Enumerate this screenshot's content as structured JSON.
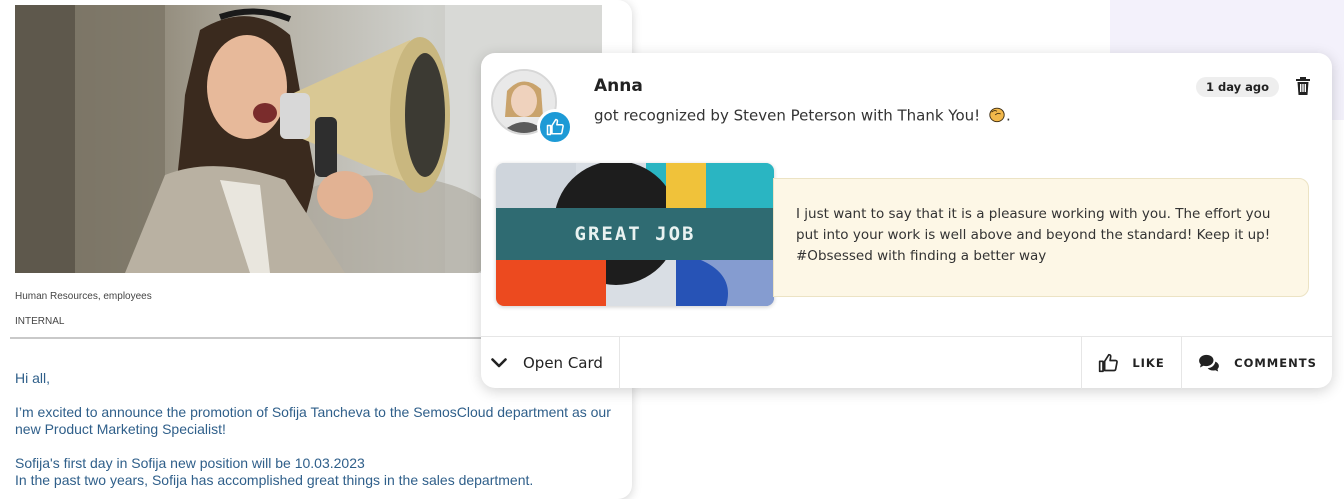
{
  "post": {
    "tags": "Human Resources, employees",
    "visibility": "INTERNAL",
    "greeting": "Hi all,",
    "paragraph1": "I’m excited to announce the promotion of Sofija Tancheva to the SemosCloud department as our new Product Marketing Specialist!",
    "line1": "Sofija's first day in Sofija new position will be 10.03.2023",
    "line2": "In the past two years, Sofija has accomplished great things in the sales department."
  },
  "recognition": {
    "name": "Anna",
    "text": "got recognized by Steven Peterson with Thank You!",
    "suffix": ".",
    "time": "1 day ago",
    "card_label": "GREAT JOB",
    "message": "I just want to say that it is a pleasure working with you. The effort you put into your work is well above and beyond the standard! Keep it up! #Obsessed with finding a better way",
    "open_card_label": "Open Card",
    "like_label": "LIKE",
    "comments_label": "COMMENTS",
    "icons": {
      "avatar": "avatar",
      "badge": "thumbs-up-icon",
      "emoji": "clapping-hands-icon",
      "delete": "trash-icon",
      "expand": "chevron-down-icon",
      "like": "thumbs-up-outline-icon",
      "comments": "comments-icon"
    },
    "colors": {
      "badge": "#1d9ad6",
      "message_bg": "#fdf7e6",
      "banner": "#2f6b72"
    }
  }
}
